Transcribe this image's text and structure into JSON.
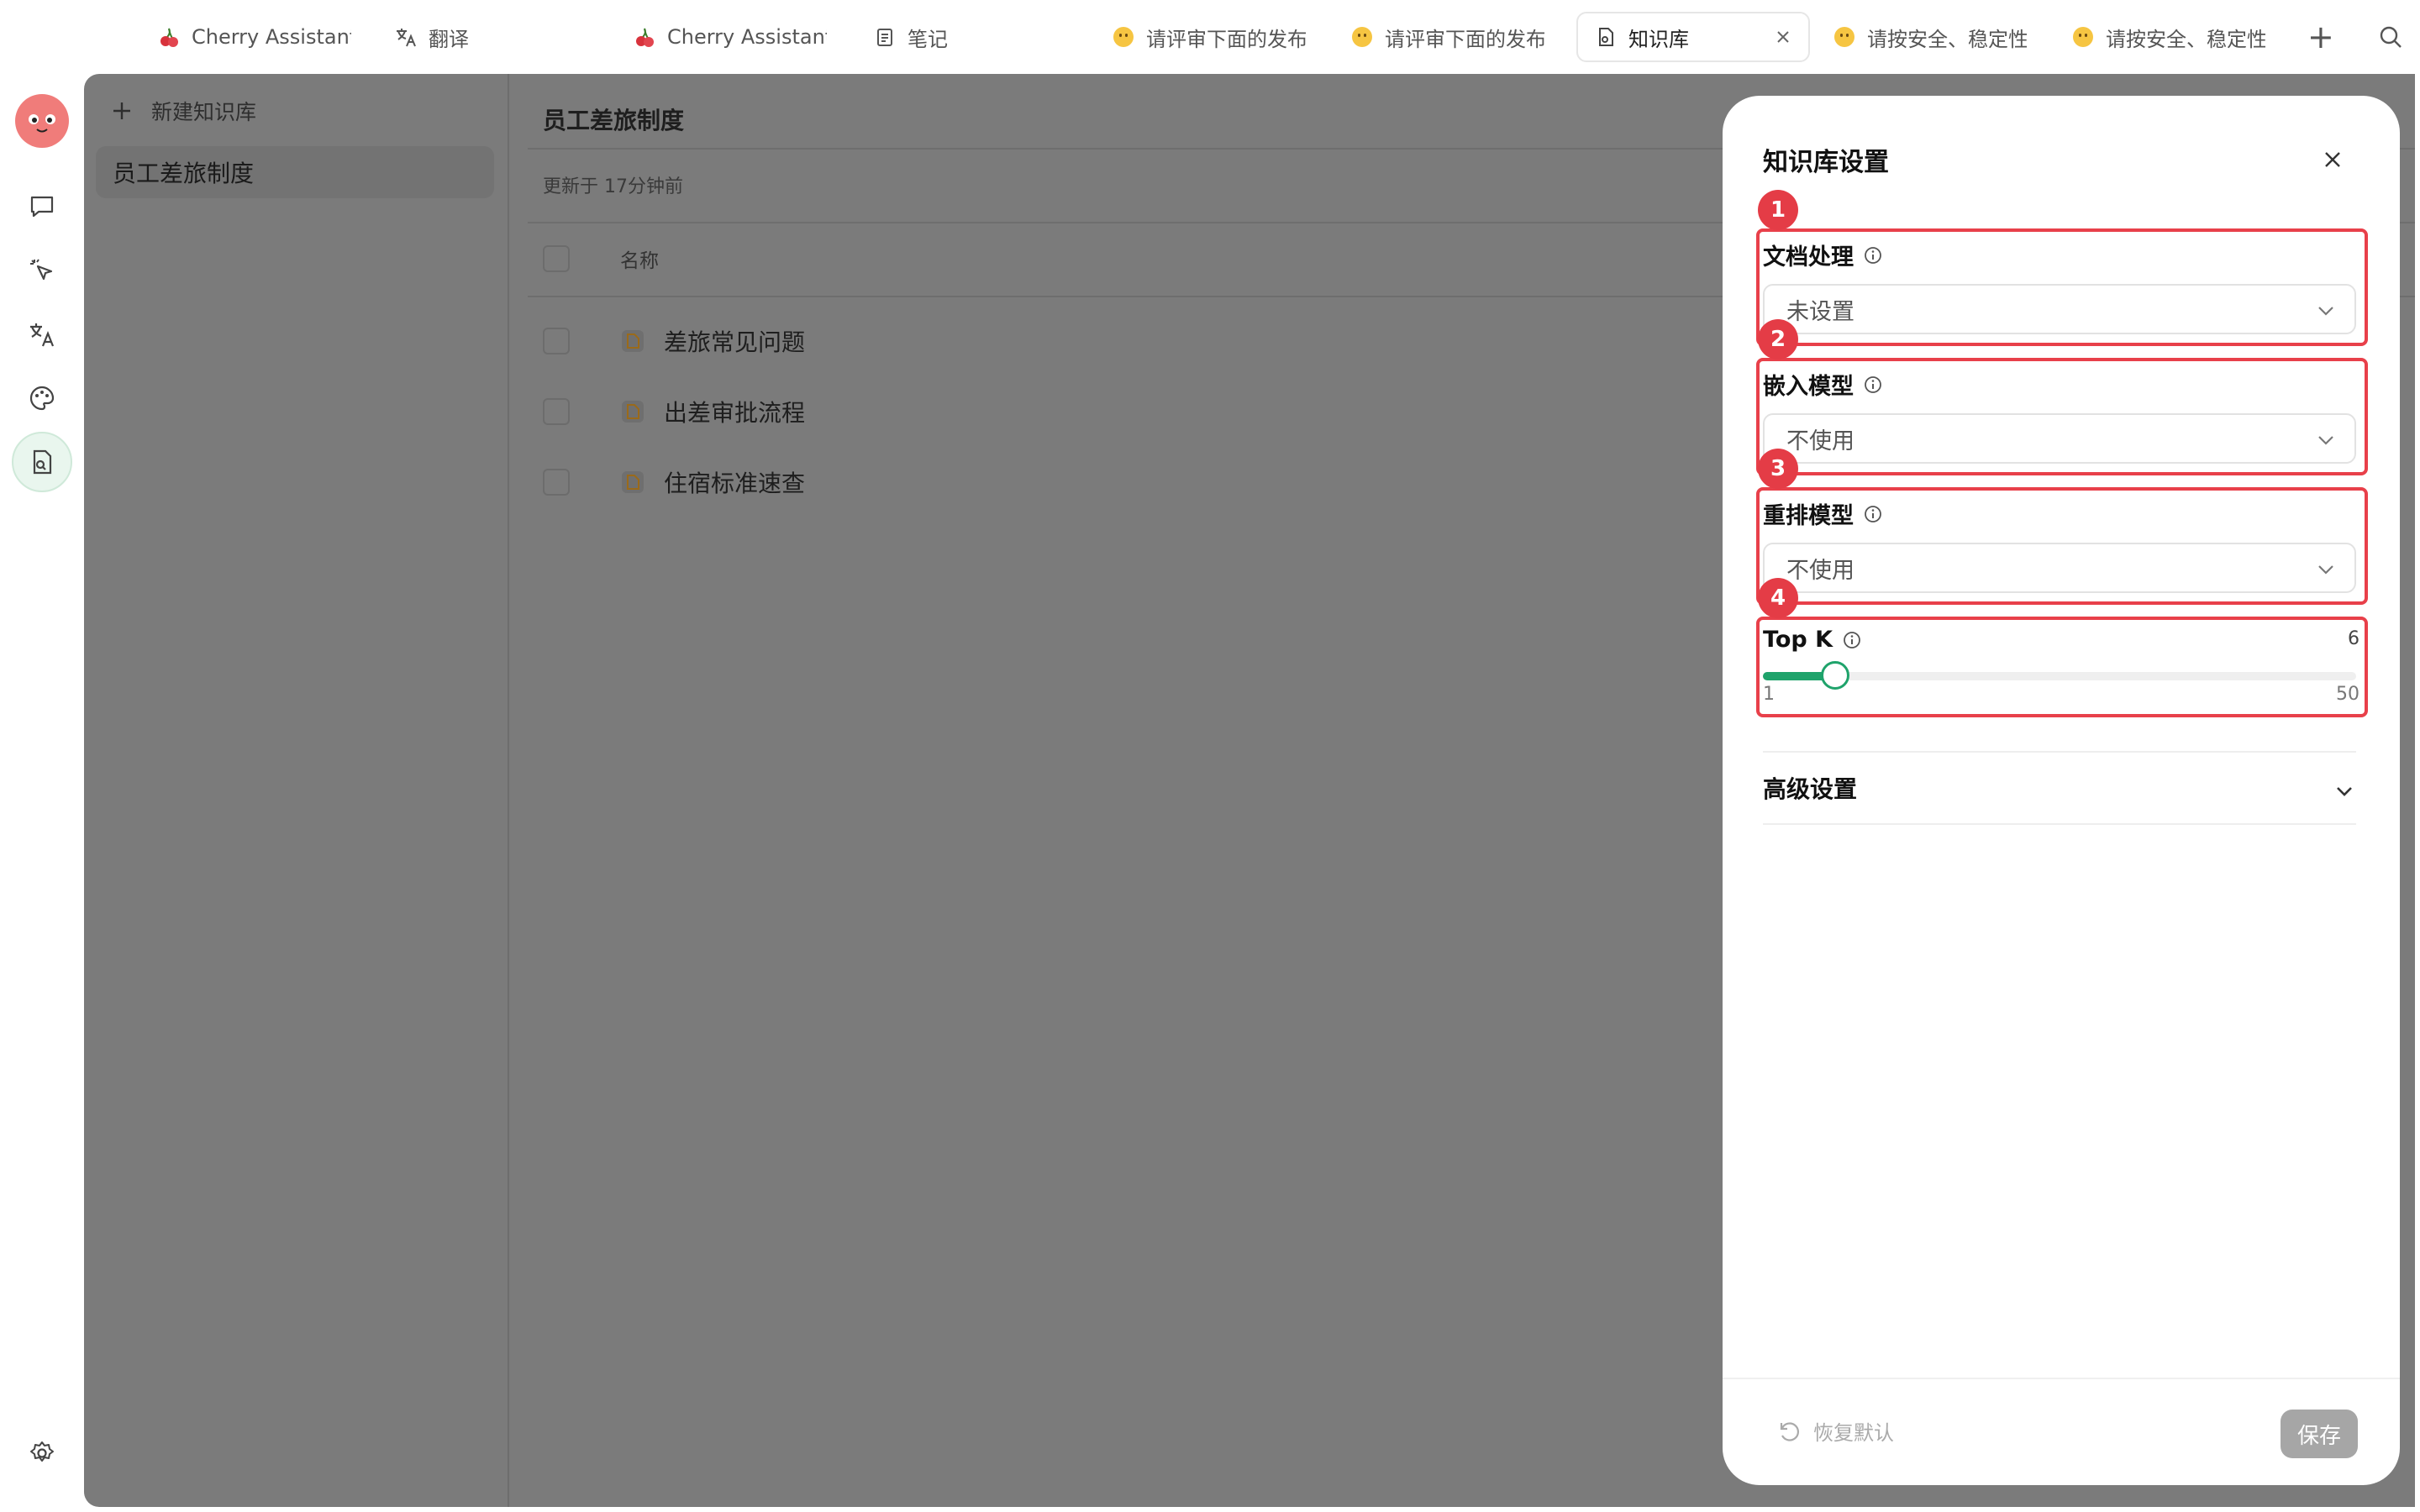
{
  "tabs": [
    {
      "label": "Cherry Assistant",
      "icon": "cherry-icon"
    },
    {
      "label": "翻译",
      "icon": "translate-icon"
    },
    {
      "label": "Cherry Assistant",
      "icon": "cherry-icon"
    },
    {
      "label": "笔记",
      "icon": "notes-icon"
    },
    {
      "label": "请评审下面的发布",
      "icon": "emoji-icon"
    },
    {
      "label": "请评审下面的发布",
      "icon": "emoji-icon"
    },
    {
      "label": "知识库",
      "icon": "knowledge-icon",
      "active": true
    },
    {
      "label": "请按安全、稳定性",
      "icon": "emoji-icon"
    },
    {
      "label": "请按安全、稳定性",
      "icon": "emoji-icon"
    }
  ],
  "tabbar": {
    "add": "+",
    "search_icon": "search-icon"
  },
  "sidebar": {
    "items": [
      "chat-icon",
      "agent-cursor-icon",
      "translate-icon",
      "palette-icon",
      "knowledge-base-icon"
    ],
    "bottom": "settings-icon"
  },
  "knowledge": {
    "new_label": "新建知识库",
    "items": [
      "员工差旅制度"
    ],
    "title": "员工差旅制度",
    "updated": "更新于 17分钟前",
    "column_name": "名称",
    "files": [
      "差旅常见问题",
      "出差审批流程",
      "住宿标准速查"
    ]
  },
  "panel": {
    "title": "知识库设置",
    "doc_processing": {
      "label": "文档处理",
      "value": "未设置"
    },
    "embedding": {
      "label": "嵌入模型",
      "value": "不使用"
    },
    "rerank": {
      "label": "重排模型",
      "value": "不使用"
    },
    "topk": {
      "label": "Top K",
      "value": "6",
      "min": "1",
      "max": "50"
    },
    "advanced": "高级设置",
    "reset": "恢复默认",
    "save": "保存"
  },
  "badges": [
    "1",
    "2",
    "3",
    "4"
  ],
  "colors": {
    "accent": "#1fa36b",
    "highlight": "#e8404a",
    "overlay": "#7b7b7b"
  }
}
